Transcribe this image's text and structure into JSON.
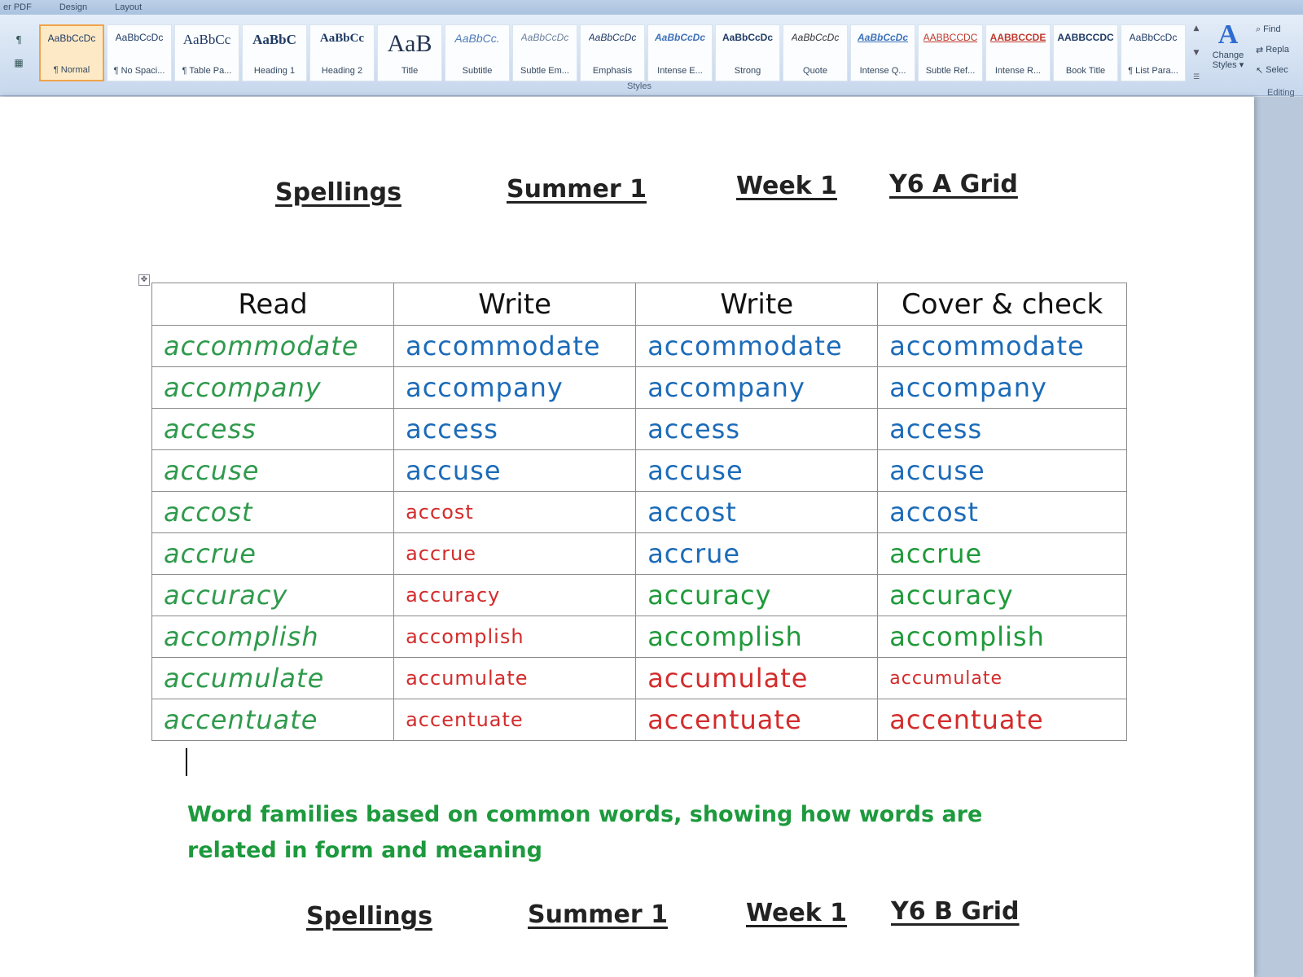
{
  "ribbon": {
    "tabs": [
      "er PDF",
      "Design",
      "Layout"
    ],
    "styles": [
      {
        "sample": "AaBbCcDc",
        "name": "¶ Normal",
        "selected": true
      },
      {
        "sample": "AaBbCcDc",
        "name": "¶ No Spaci..."
      },
      {
        "sample": "AaBbCc",
        "name": "¶ Table Pa..."
      },
      {
        "sample": "AaBbC",
        "name": "Heading 1"
      },
      {
        "sample": "AaBbCc",
        "name": "Heading 2"
      },
      {
        "sample": "AaB",
        "name": "Title"
      },
      {
        "sample": "AaBbCc.",
        "name": "Subtitle"
      },
      {
        "sample": "AaBbCcDc",
        "name": "Subtle Em..."
      },
      {
        "sample": "AaBbCcDc",
        "name": "Emphasis"
      },
      {
        "sample": "AaBbCcDc",
        "name": "Intense E..."
      },
      {
        "sample": "AaBbCcDc",
        "name": "Strong"
      },
      {
        "sample": "AaBbCcDc",
        "name": "Quote"
      },
      {
        "sample": "AaBbCcDc",
        "name": "Intense Q..."
      },
      {
        "sample": "AABBCCDC",
        "name": "Subtle Ref..."
      },
      {
        "sample": "AABBCCDE",
        "name": "Intense R..."
      },
      {
        "sample": "AABBCCDC",
        "name": "Book Title"
      },
      {
        "sample": "AaBbCcDc",
        "name": "¶ List Para..."
      }
    ],
    "change_styles_glyph": "A",
    "change_styles_label_1": "Change",
    "change_styles_label_2": "Styles ▾",
    "styles_group_label": "Styles",
    "editing": {
      "find": "Find",
      "replace": "Repla",
      "select": "Selec",
      "label": "Editing"
    }
  },
  "document": {
    "heading_a": [
      "Spellings",
      "Summer 1",
      "Week 1",
      "Y6 A Grid"
    ],
    "heading_b": [
      "Spellings",
      "Summer 1",
      "Week 1",
      "Y6 B Grid"
    ],
    "table": {
      "headers": [
        "Read",
        "Write",
        "Write",
        "Cover & check"
      ],
      "rows": [
        [
          "accommodate",
          "accommodate",
          "accommodate",
          "accommodate"
        ],
        [
          "accompany",
          "accompany",
          "accompany",
          "accompany"
        ],
        [
          "access",
          "access",
          "access",
          "access"
        ],
        [
          "accuse",
          "accuse",
          "accuse",
          "accuse"
        ],
        [
          "accost",
          "accost",
          "accost",
          "accost"
        ],
        [
          "accrue",
          "accrue",
          "accrue",
          "accrue"
        ],
        [
          "accuracy",
          "accuracy",
          "accuracy",
          "accuracy"
        ],
        [
          "accomplish",
          "accomplish",
          "accomplish",
          "accomplish"
        ],
        [
          "accumulate",
          "accumulate",
          "accumulate",
          "accumulate"
        ],
        [
          "accentuate",
          "accentuate",
          "accentuate",
          "accentuate"
        ]
      ]
    },
    "note": "Word families based on common words, showing how words are related in form and meaning"
  },
  "colors": {
    "read_green": "#2f9a4c",
    "blue": "#1c6bb8",
    "red": "#d32c2c",
    "note_green": "#1d9a3d"
  }
}
